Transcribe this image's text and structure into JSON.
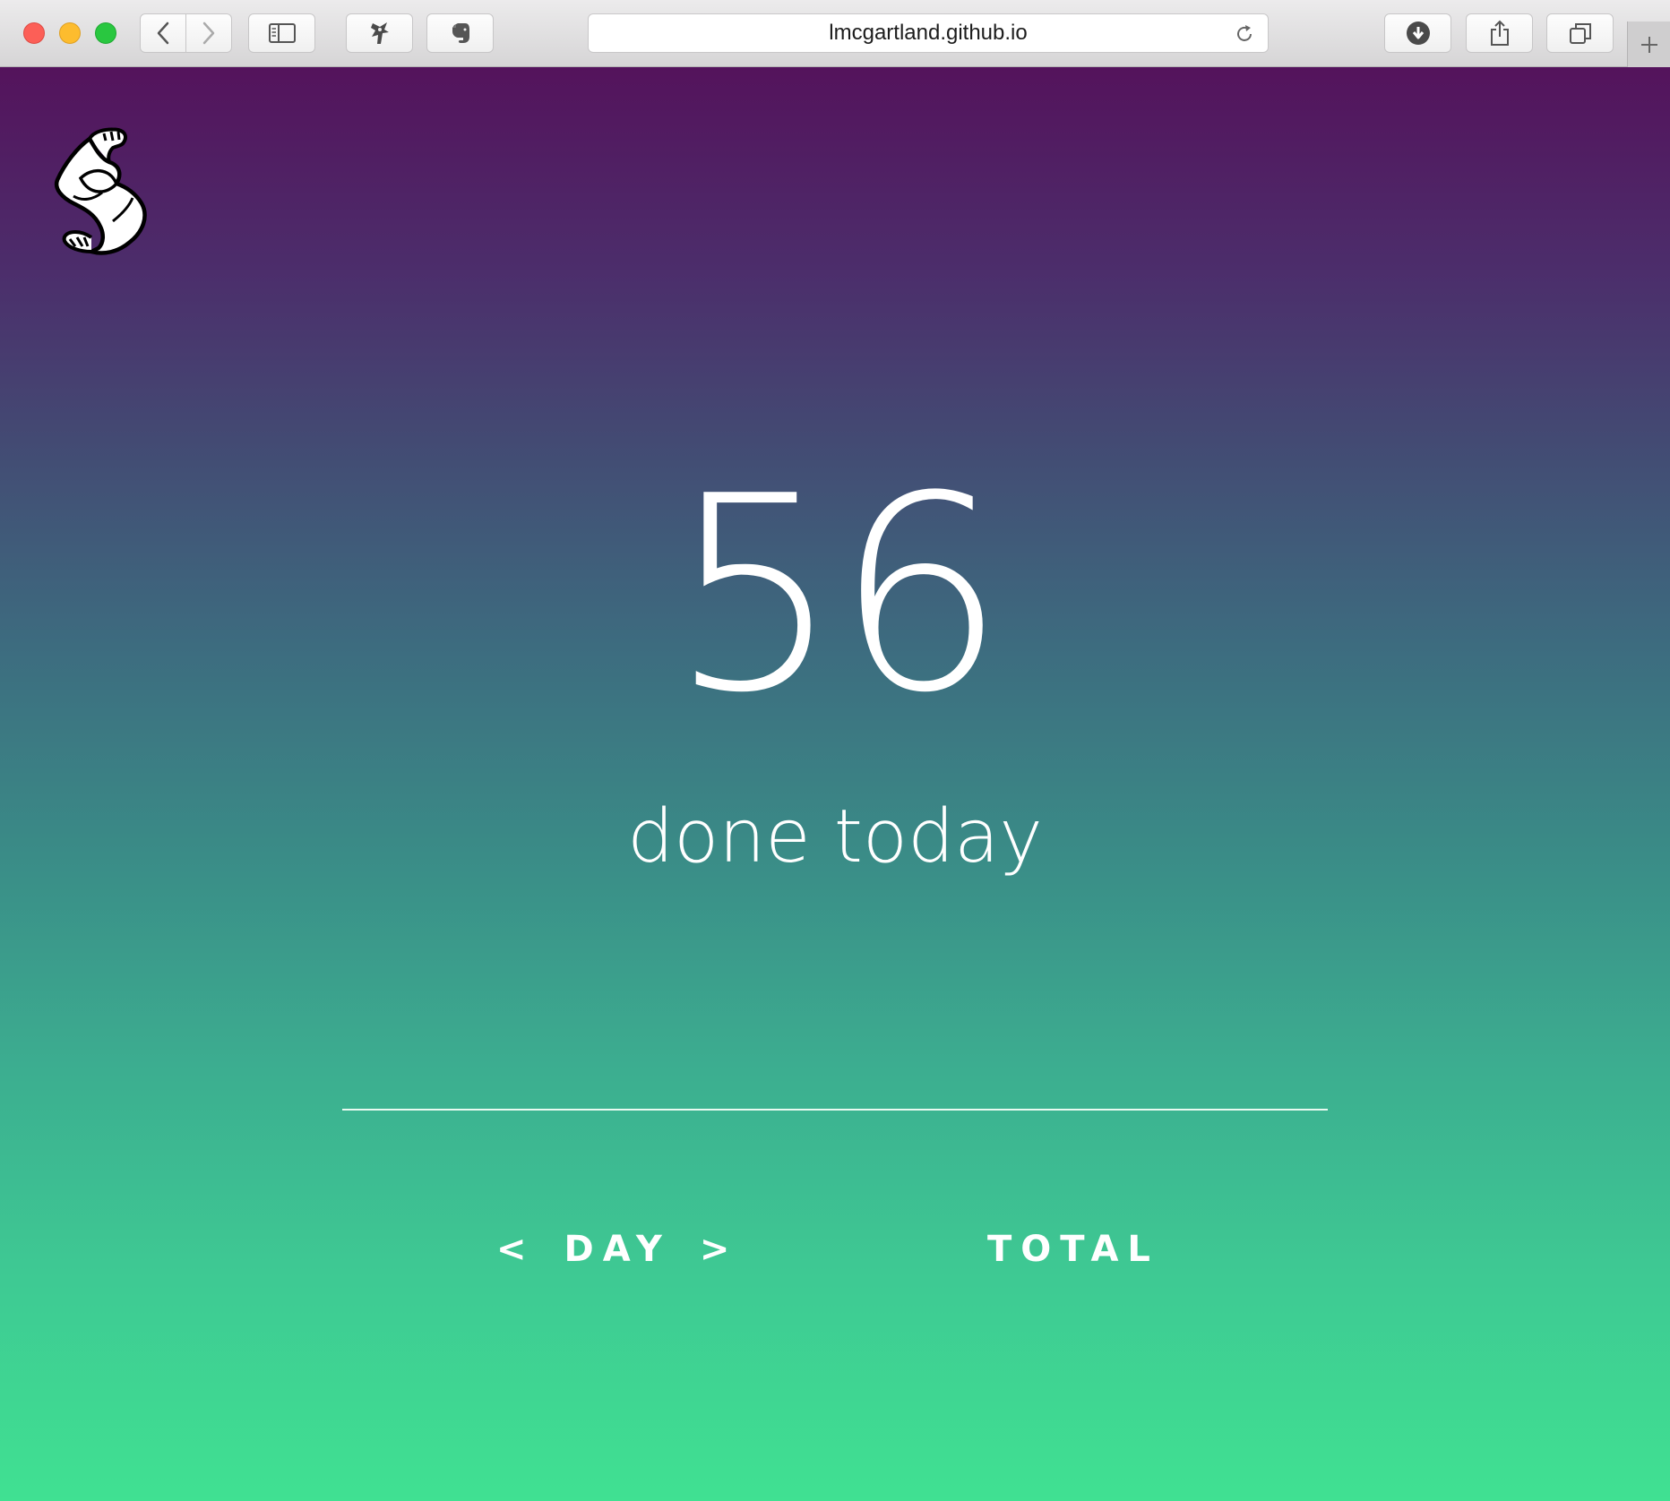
{
  "browser": {
    "url": "lmcgartland.github.io",
    "buttons": {
      "back": "chevron-left-icon",
      "forward": "chevron-right-icon",
      "sidebar": "sidebar-icon",
      "extension_1": "ninja-extension-icon",
      "extension_2": "evernote-elephant-icon",
      "reload": "reload-icon",
      "download": "download-icon",
      "share": "share-icon",
      "tabs": "tabs-overview-icon",
      "new_tab": "plus-icon"
    },
    "traffic_lights": {
      "close": "#fc5f57",
      "minimize": "#fdbc2e",
      "maximize": "#29c740"
    }
  },
  "page": {
    "logo_icon": "flexing-arm-icon",
    "count": "56",
    "subtitle": "done today",
    "nav": {
      "prev": "<",
      "day_label": "DAY",
      "next": ">",
      "total_label": "TOTAL"
    },
    "colors": {
      "gradient_top": "#54135c",
      "gradient_bottom": "#40e192",
      "text": "#ffffff"
    }
  }
}
